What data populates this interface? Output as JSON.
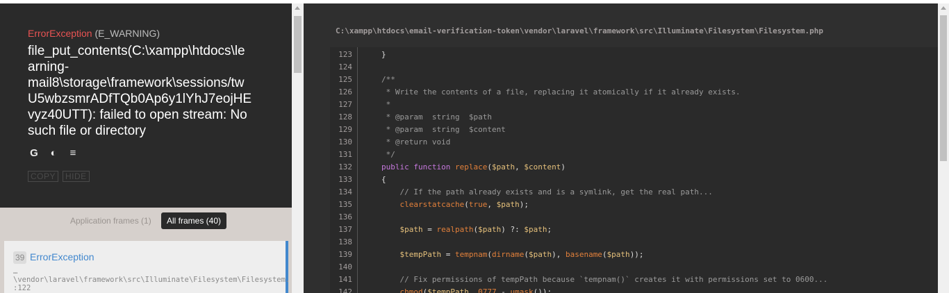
{
  "exception": {
    "class": "ErrorException",
    "type": "(E_WARNING)",
    "message_lines": [
      "file_put_contents(C:\\xampp\\htdocs\\le",
      "arning-",
      "mail8\\storage\\framework\\sessions/tw",
      "U5wbzsmrADfTQb0Ap6y1lYhJ7eojHE",
      "vyz40UTT): failed to open stream: No",
      "such file or directory"
    ]
  },
  "search_icons": [
    "google-icon",
    "duckduckgo-icon",
    "stackoverflow-icon"
  ],
  "search_glyphs": {
    "google": "G",
    "duckduckgo": "◐",
    "stackoverflow": "≡"
  },
  "buttons": {
    "copy": "COPY",
    "hide": "HIDE"
  },
  "frame_tabs": {
    "application": "Application frames (1)",
    "all": "All frames (40)"
  },
  "frames": [
    {
      "index": "39",
      "class": "ErrorException",
      "file_lines": [
        "…",
        "\\vendor\\laravel\\framework\\src\\Illuminate\\Filesystem\\Filesystem.php",
        ":122"
      ]
    }
  ],
  "code_view": {
    "file_path": "C:\\xampp\\htdocs\\email-verification-token\\vendor\\laravel\\framework\\src\\Illuminate\\Filesystem\\Filesystem.php",
    "lines": [
      {
        "n": "123",
        "segments": [
          [
            "plain",
            "}"
          ]
        ]
      },
      {
        "n": "124",
        "segments": []
      },
      {
        "n": "125",
        "segments": [
          [
            "comment",
            "/**"
          ]
        ]
      },
      {
        "n": "126",
        "segments": [
          [
            "comment",
            " * Write the contents of a file, replacing it atomically if it already exists."
          ]
        ]
      },
      {
        "n": "127",
        "segments": [
          [
            "comment",
            " *"
          ]
        ]
      },
      {
        "n": "128",
        "segments": [
          [
            "comment",
            " * @param  string  $path"
          ]
        ]
      },
      {
        "n": "129",
        "segments": [
          [
            "comment",
            " * @param  string  $content"
          ]
        ]
      },
      {
        "n": "130",
        "segments": [
          [
            "comment",
            " * @return void"
          ]
        ]
      },
      {
        "n": "131",
        "segments": [
          [
            "comment",
            " */"
          ]
        ]
      },
      {
        "n": "132",
        "segments": [
          [
            "kw",
            "public function "
          ],
          [
            "fn",
            "replace"
          ],
          [
            "plain",
            "("
          ],
          [
            "var",
            "$path"
          ],
          [
            "plain",
            ", "
          ],
          [
            "var",
            "$content"
          ],
          [
            "plain",
            ")"
          ]
        ]
      },
      {
        "n": "133",
        "segments": [
          [
            "plain",
            "{"
          ]
        ]
      },
      {
        "n": "134",
        "segments": [
          [
            "comment",
            "    // If the path already exists and is a symlink, get the real path..."
          ]
        ]
      },
      {
        "n": "135",
        "segments": [
          [
            "plain",
            "    "
          ],
          [
            "fn",
            "clearstatcache"
          ],
          [
            "plain",
            "("
          ],
          [
            "fn",
            "true"
          ],
          [
            "plain",
            ", "
          ],
          [
            "var",
            "$path"
          ],
          [
            "plain",
            ");"
          ]
        ]
      },
      {
        "n": "136",
        "segments": []
      },
      {
        "n": "137",
        "segments": [
          [
            "plain",
            "    "
          ],
          [
            "var",
            "$path"
          ],
          [
            "plain",
            " = "
          ],
          [
            "fn",
            "realpath"
          ],
          [
            "plain",
            "("
          ],
          [
            "var",
            "$path"
          ],
          [
            "plain",
            ") ?: "
          ],
          [
            "var",
            "$path"
          ],
          [
            "plain",
            ";"
          ]
        ]
      },
      {
        "n": "138",
        "segments": []
      },
      {
        "n": "139",
        "segments": [
          [
            "plain",
            "    "
          ],
          [
            "var",
            "$tempPath"
          ],
          [
            "plain",
            " = "
          ],
          [
            "fn",
            "tempnam"
          ],
          [
            "plain",
            "("
          ],
          [
            "fn",
            "dirname"
          ],
          [
            "plain",
            "("
          ],
          [
            "var",
            "$path"
          ],
          [
            "plain",
            "), "
          ],
          [
            "fn",
            "basename"
          ],
          [
            "plain",
            "("
          ],
          [
            "var",
            "$path"
          ],
          [
            "plain",
            "));"
          ]
        ]
      },
      {
        "n": "140",
        "segments": []
      },
      {
        "n": "141",
        "segments": [
          [
            "comment",
            "    // Fix permissions of tempPath because `tempnam()` creates it with permissions set to 0600..."
          ]
        ]
      },
      {
        "n": "142",
        "segments": [
          [
            "plain",
            "    "
          ],
          [
            "fn",
            "chmod"
          ],
          [
            "plain",
            "("
          ],
          [
            "var",
            "$tempPath"
          ],
          [
            "plain",
            ", "
          ],
          [
            "fn",
            "0777"
          ],
          [
            "plain",
            " - "
          ],
          [
            "fn",
            "umask"
          ],
          [
            "plain",
            "());"
          ]
        ]
      }
    ]
  },
  "colors": {
    "panel_bg": "#2a2a2a",
    "exception_class": "#e95353",
    "accent_blue": "#4288ce",
    "frames_bg": "#d6d0cc"
  }
}
